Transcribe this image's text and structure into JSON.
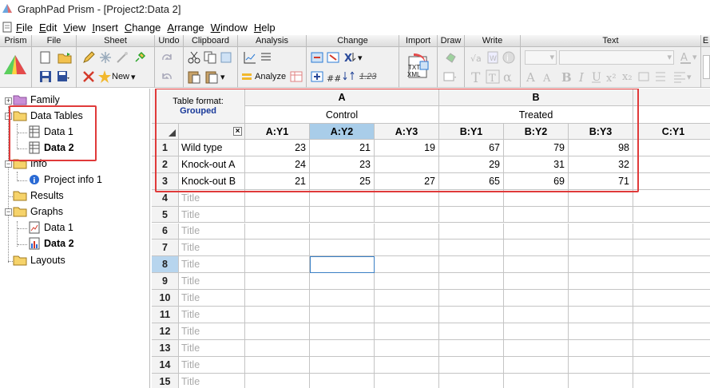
{
  "window": {
    "title": "GraphPad Prism - [Project2:Data 2]"
  },
  "menu": [
    "File",
    "Edit",
    "View",
    "Insert",
    "Change",
    "Arrange",
    "Window",
    "Help"
  ],
  "menu_underline": [
    "F",
    "E",
    "V",
    "I",
    "C",
    "A",
    "W",
    "H"
  ],
  "ribbon": {
    "groups": [
      "Prism",
      "File",
      "Sheet",
      "Undo",
      "Clipboard",
      "Analysis",
      "Change",
      "Import",
      "Draw",
      "Write",
      "Text",
      "E"
    ],
    "sheet_new_label": "New",
    "analyze_label": "Analyze",
    "change_123": "1.23",
    "import_txt": "TXT",
    "import_xml": "XML"
  },
  "navigator": {
    "family": "Family",
    "data_tables": "Data Tables",
    "data1": "Data 1",
    "data2": "Data 2",
    "info": "Info",
    "project_info": "Project info 1",
    "results": "Results",
    "graphs": "Graphs",
    "graph_data1": "Data 1",
    "graph_data2": "Data 2",
    "layouts": "Layouts"
  },
  "table": {
    "format_label": "Table format:",
    "format_value": "Grouped",
    "group_a": "A",
    "group_b": "B",
    "group_a_title": "Control",
    "group_b_title": "Treated",
    "columns": [
      "A:Y1",
      "A:Y2",
      "A:Y3",
      "B:Y1",
      "B:Y2",
      "B:Y3",
      "C:Y1"
    ],
    "close_glyph": "×",
    "rows": [
      {
        "num": "1",
        "title": "Wild type",
        "values": [
          "23",
          "21",
          "19",
          "67",
          "79",
          "98",
          ""
        ]
      },
      {
        "num": "2",
        "title": "Knock-out A",
        "values": [
          "24",
          "23",
          "",
          "29",
          "31",
          "32",
          ""
        ]
      },
      {
        "num": "3",
        "title": "Knock-out B",
        "values": [
          "21",
          "25",
          "27",
          "65",
          "69",
          "71",
          ""
        ]
      }
    ],
    "empty_rows": [
      "4",
      "5",
      "6",
      "7",
      "8",
      "9",
      "10",
      "11",
      "12",
      "13",
      "14",
      "15"
    ],
    "empty_title": "Title"
  },
  "colors": {
    "highlight": "#e03a3a",
    "selection": "#a9cde9",
    "format_value": "#1a3a9a"
  }
}
